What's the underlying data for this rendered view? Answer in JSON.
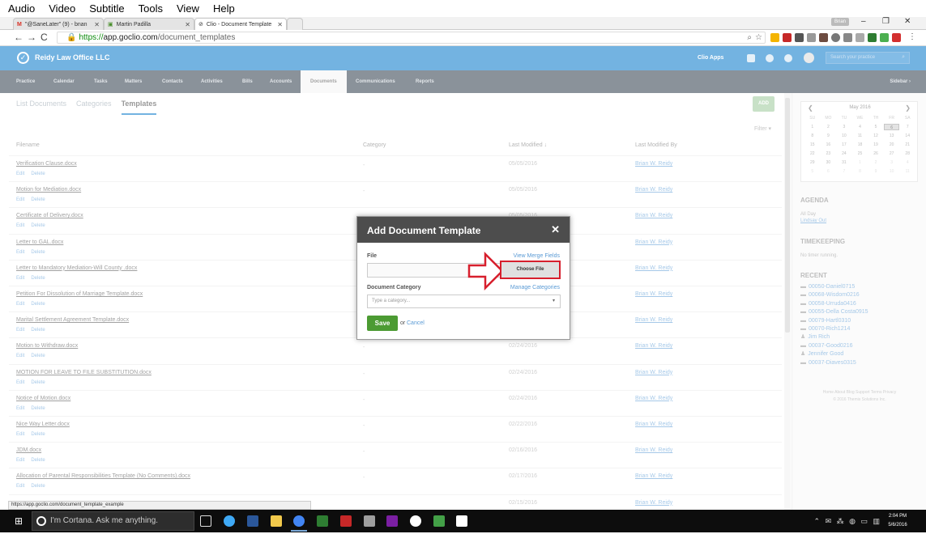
{
  "menubar": {
    "items": [
      "Audio",
      "Video",
      "Subtitle",
      "Tools",
      "View",
      "Help"
    ]
  },
  "browser": {
    "tabs": [
      {
        "label": "\"@SaneLater\" (9) - bnan",
        "icon": "gmail-icon"
      },
      {
        "label": "Martin Padilla",
        "icon": "page-icon"
      },
      {
        "label": "Clio - Document Template",
        "icon": "clio-icon"
      }
    ],
    "profile": "Brian",
    "url_scheme": "https://",
    "url_host": "app.goclio.com",
    "url_path": "/document_templates"
  },
  "clio": {
    "firm": "Reidy Law Office LLC",
    "apps_label": "Clio Apps",
    "search_placeholder": "Search your practice",
    "nav": [
      "Practice",
      "Calendar",
      "Tasks",
      "Matters",
      "Contacts",
      "Activities",
      "Bills",
      "Accounts",
      "Documents",
      "Communications",
      "Reports"
    ],
    "nav_active": "Documents",
    "sidebar_label": "Sidebar ›"
  },
  "subtabs": {
    "list": "List Documents",
    "categories": "Categories",
    "templates": "Templates"
  },
  "add_label": "ADD",
  "filter_label": "Filter ▾",
  "table": {
    "headers": {
      "filename": "Filename",
      "category": "Category",
      "last_modified": "Last Modified ↓",
      "last_modified_by": "Last Modified By"
    },
    "edit_label": "Edit",
    "delete_label": "Delete",
    "rows": [
      {
        "filename": "Verification Clause.docx",
        "category": "-",
        "modified": "05/05/2016",
        "by": "Brian W. Reidy"
      },
      {
        "filename": "Motion for Mediation.docx",
        "category": "-",
        "modified": "05/05/2016",
        "by": "Brian W. Reidy"
      },
      {
        "filename": "Certificate of Delivery.docx",
        "category": "-",
        "modified": "05/05/2016",
        "by": "Brian W. Reidy"
      },
      {
        "filename": "Letter to GAL.docx",
        "category": "-",
        "modified": "",
        "by": "Brian W. Reidy"
      },
      {
        "filename": "Letter to Mandatory Mediation-Will County .docx",
        "category": "-",
        "modified": "",
        "by": "Brian W. Reidy"
      },
      {
        "filename": "Petition For Dissolution of Marriage Template.docx",
        "category": "-",
        "modified": "",
        "by": "Brian W. Reidy"
      },
      {
        "filename": "Marital Settlement Agreement Template.docx",
        "category": "-",
        "modified": "",
        "by": "Brian W. Reidy"
      },
      {
        "filename": "Motion to Withdraw.docx",
        "category": "-",
        "modified": "02/24/2016",
        "by": "Brian W. Reidy"
      },
      {
        "filename": "MOTION FOR LEAVE TO FILE SUBSTITUTION.docx",
        "category": "-",
        "modified": "02/24/2016",
        "by": "Brian W. Reidy"
      },
      {
        "filename": "Notice of Motion.docx",
        "category": "-",
        "modified": "02/24/2016",
        "by": "Brian W. Reidy"
      },
      {
        "filename": "Nice Way Letter.docx",
        "category": "-",
        "modified": "02/22/2016",
        "by": "Brian W. Reidy"
      },
      {
        "filename": "JDM.docx",
        "category": "-",
        "modified": "02/16/2016",
        "by": "Brian W. Reidy"
      },
      {
        "filename": "Allocation of Parental Responsibilities Template (No Comments).docx",
        "category": "-",
        "modified": "02/17/2016",
        "by": "Brian W. Reidy"
      },
      {
        "filename": "",
        "category": "",
        "modified": "02/15/2016",
        "by": "Brian W. Reidy"
      }
    ]
  },
  "sidebar": {
    "calendar": {
      "month": "May 2016",
      "days": [
        "SU",
        "MO",
        "TU",
        "WE",
        "TH",
        "FR",
        "SA"
      ],
      "cells": [
        "1",
        "2",
        "3",
        "4",
        "5",
        "6",
        "7",
        "8",
        "9",
        "10",
        "11",
        "12",
        "13",
        "14",
        "15",
        "16",
        "17",
        "18",
        "19",
        "20",
        "21",
        "22",
        "23",
        "24",
        "25",
        "26",
        "27",
        "28",
        "29",
        "30",
        "31",
        "1",
        "2",
        "3",
        "4",
        "5",
        "6",
        "7",
        "8",
        "9",
        "10",
        "11"
      ],
      "today": "6"
    },
    "agenda_title": "AGENDA",
    "agenda_allday": "All Day",
    "agenda_item": "Lindsay Out",
    "timekeeping_title": "TIMEKEEPING",
    "timekeeping_text": "No timer running.",
    "recent_title": "RECENT",
    "recent": [
      {
        "icon": "matter-icon",
        "label": "00050-Daniel0715"
      },
      {
        "icon": "matter-icon",
        "label": "00068-Wisdom0216"
      },
      {
        "icon": "matter-icon",
        "label": "00058-Urruda0416"
      },
      {
        "icon": "matter-icon",
        "label": "00055-Della Costa0915"
      },
      {
        "icon": "matter-icon",
        "label": "00079-Hartl0310"
      },
      {
        "icon": "matter-icon",
        "label": "00070-Rich1214"
      },
      {
        "icon": "person-icon",
        "label": "Jim Rich"
      },
      {
        "icon": "matter-icon",
        "label": "00037-Good0216"
      },
      {
        "icon": "person-icon",
        "label": "Jennifer Good"
      },
      {
        "icon": "matter-icon",
        "label": "00037-Diaves0315"
      }
    ],
    "footer_links": "Home  About  Blog  Support  Terms  Privacy",
    "copyright": "© 2016 Themis Solutions Inc."
  },
  "modal": {
    "title": "Add Document Template",
    "file_label": "File",
    "view_merge_fields": "View Merge Fields",
    "choose_file": "Choose File",
    "category_label": "Document Category",
    "manage_categories": "Manage Categories",
    "category_placeholder": "Type a category...",
    "save": "Save",
    "or": "or",
    "cancel": "Cancel"
  },
  "statusbar_url": "https://app.goclio.com/document_template_example",
  "taskbar": {
    "cortana": "I'm Cortana. Ask me anything.",
    "time": "2:04 PM",
    "date": "5/6/2016"
  },
  "colors": {
    "clio_blue": "#0075c9",
    "nav_dark": "#2b3a48",
    "save_green": "#4c9b33",
    "highlight_red": "#d71f2d"
  }
}
